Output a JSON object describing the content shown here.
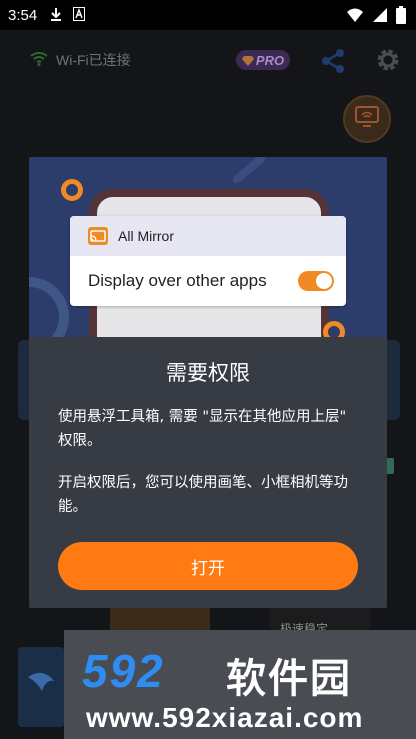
{
  "status_bar": {
    "time": "3:54"
  },
  "header": {
    "wifi_label": "Wi-Fi已连接",
    "pro_badge": "PRO"
  },
  "dialog": {
    "permission_card": {
      "app_name": "All Mirror",
      "setting_label": "Display over other apps",
      "toggle_on": true
    },
    "title": "需要权限",
    "message_1": "使用悬浮工具箱, 需要 \"显示在其他应用上层\" 权限。",
    "message_2": "开启权限后，您可以使用画笔、小框相机等功能。",
    "open_button_label": "打开"
  },
  "background": {
    "partial_label": "极速稳定"
  },
  "watermark": {
    "logo_number": "592",
    "logo_text": "软件园",
    "url": "www.592xiazai.com"
  },
  "colors": {
    "accent": "#ff7a12",
    "dialog_bg": "#373b44",
    "hero_bg": "#2c3d6c",
    "watermark_blue": "#2f8cf0"
  }
}
